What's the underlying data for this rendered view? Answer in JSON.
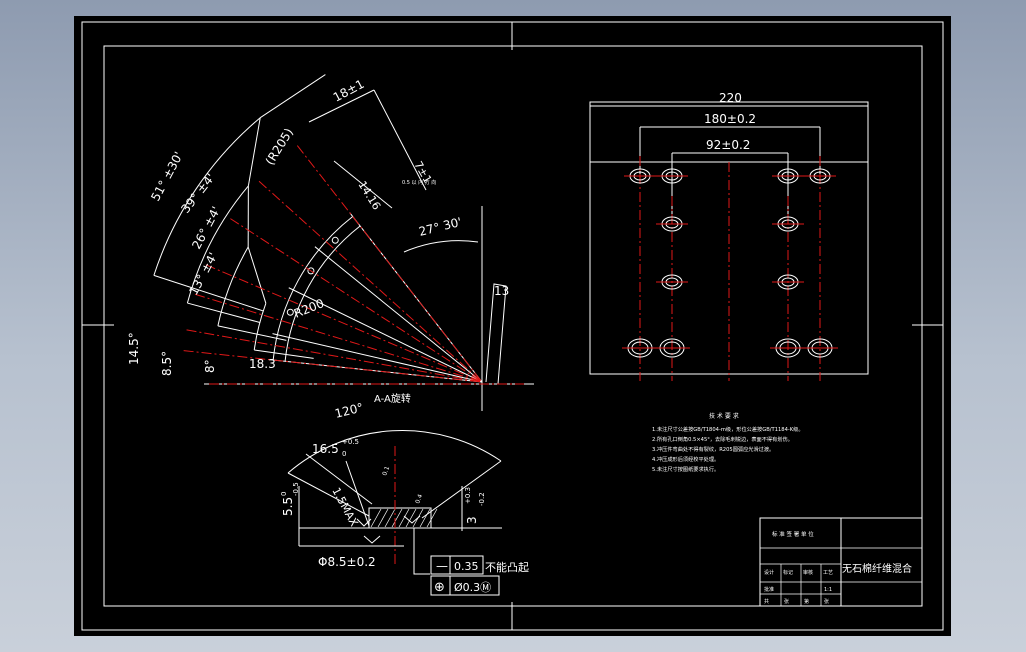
{
  "arc_view": {
    "dims": {
      "r205": "(R205)",
      "r200": "R200",
      "d18": "18±1",
      "d7": "7±1",
      "d14_16": "14.16",
      "a27": "27° 30'",
      "d13": "13",
      "a51": "51° ±30'",
      "a39": "39° ±4'",
      "a26": "26° ±4'",
      "a13": "13° ±4'",
      "d14_5": "14.5°",
      "d8_5": "8.5°",
      "d8": "8°",
      "d18_3": "18.3",
      "note_tiny": "0.5 以 内 方 向"
    }
  },
  "section_view": {
    "title": "A-A旋转",
    "dims": {
      "a120": "120°",
      "d16_5": "16.5",
      "d16_5_tol": "+0.5",
      "d16_5_tol2": "0",
      "d1_5max": "1.5MAX",
      "d5_5": "5.5",
      "d5_5_tol": "0",
      "d5_5_tol2": "-0.5",
      "d3": "3",
      "d3_tol": "+0.3",
      "d3_tol2": "-0.2",
      "phi8_5": "Φ8.5±0.2",
      "small_a": "0.1",
      "small_b": "0.4"
    },
    "tolerance_frame": {
      "row1_sym": "—",
      "row1_val": "0.35",
      "row1_note": "不能凸起",
      "row2_sym": "⊕",
      "row2_val": "Ø0.3Ⓜ"
    }
  },
  "plate_view": {
    "dims": {
      "d220": "220",
      "d180": "180±0.2",
      "d92": "92±0.2"
    }
  },
  "notes": {
    "title": "技 术 要 求",
    "lines": [
      "1.未注尺寸公差按GB/T1804-m级，形位公差按GB/T1184-K级。",
      "2.所有孔口倒角0.5×45°，去除毛刺锐边，表面不得有划伤。",
      "3.冲压件弯曲处不得有裂纹，R205圆弧应光滑过渡。",
      "4.冲压成形后须经校平处理。",
      "5.未注尺寸按图纸要求执行。"
    ]
  },
  "title_block": {
    "company": "标 准 签 署 单 位",
    "part_name": "无石棉纤维混合",
    "headers": [
      "设计",
      "标记",
      "审核",
      "工艺",
      "批准"
    ],
    "scale": "1:1",
    "footer": [
      "共",
      "张",
      "第",
      "张"
    ]
  }
}
